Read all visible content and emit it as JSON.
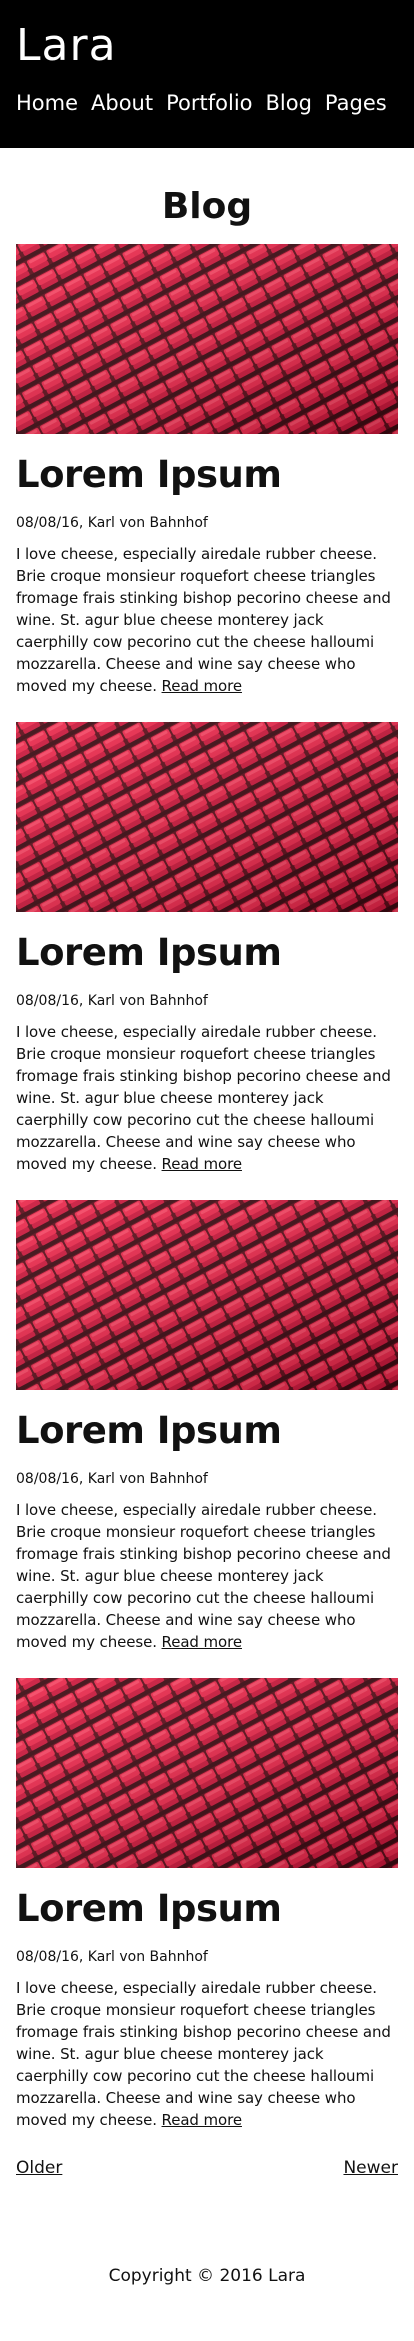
{
  "header": {
    "brand": "Lara",
    "nav": [
      "Home",
      "About",
      "Portfolio",
      "Blog",
      "Pages"
    ]
  },
  "page": {
    "title": "Blog"
  },
  "posts": [
    {
      "title": "Lorem Ipsum",
      "meta": "08/08/16, Karl von Bahnhof",
      "excerpt": "I love cheese, especially airedale rubber cheese. Brie croque monsieur roquefort cheese triangles fromage frais stinking bishop pecorino cheese and wine. St. agur blue cheese monterey jack caerphilly cow pecorino cut the cheese halloumi mozzarella. Cheese and wine say cheese who moved my cheese.",
      "read_more": "Read more",
      "image": "red-stadium-seats"
    },
    {
      "title": "Lorem Ipsum",
      "meta": "08/08/16, Karl von Bahnhof",
      "excerpt": "I love cheese, especially airedale rubber cheese. Brie croque monsieur roquefort cheese triangles fromage frais stinking bishop pecorino cheese and wine. St. agur blue cheese monterey jack caerphilly cow pecorino cut the cheese halloumi mozzarella. Cheese and wine say cheese who moved my cheese.",
      "read_more": "Read more",
      "image": "red-stadium-seats"
    },
    {
      "title": "Lorem Ipsum",
      "meta": "08/08/16, Karl von Bahnhof",
      "excerpt": "I love cheese, especially airedale rubber cheese. Brie croque monsieur roquefort cheese triangles fromage frais stinking bishop pecorino cheese and wine. St. agur blue cheese monterey jack caerphilly cow pecorino cut the cheese halloumi mozzarella. Cheese and wine say cheese who moved my cheese.",
      "read_more": "Read more",
      "image": "red-stadium-seats"
    },
    {
      "title": "Lorem Ipsum",
      "meta": "08/08/16, Karl von Bahnhof",
      "excerpt": "I love cheese, especially airedale rubber cheese. Brie croque monsieur roquefort cheese triangles fromage frais stinking bishop pecorino cheese and wine. St. agur blue cheese monterey jack caerphilly cow pecorino cut the cheese halloumi mozzarella. Cheese and wine say cheese who moved my cheese.",
      "read_more": "Read more",
      "image": "red-stadium-seats"
    }
  ],
  "pagination": {
    "older": "Older",
    "newer": "Newer"
  },
  "footer": {
    "copyright": "Copyright © 2016 Lara"
  },
  "colors": {
    "header_bg": "#000000",
    "seat_red": "#e01e3c",
    "seat_shadow": "#6a0e1e"
  }
}
